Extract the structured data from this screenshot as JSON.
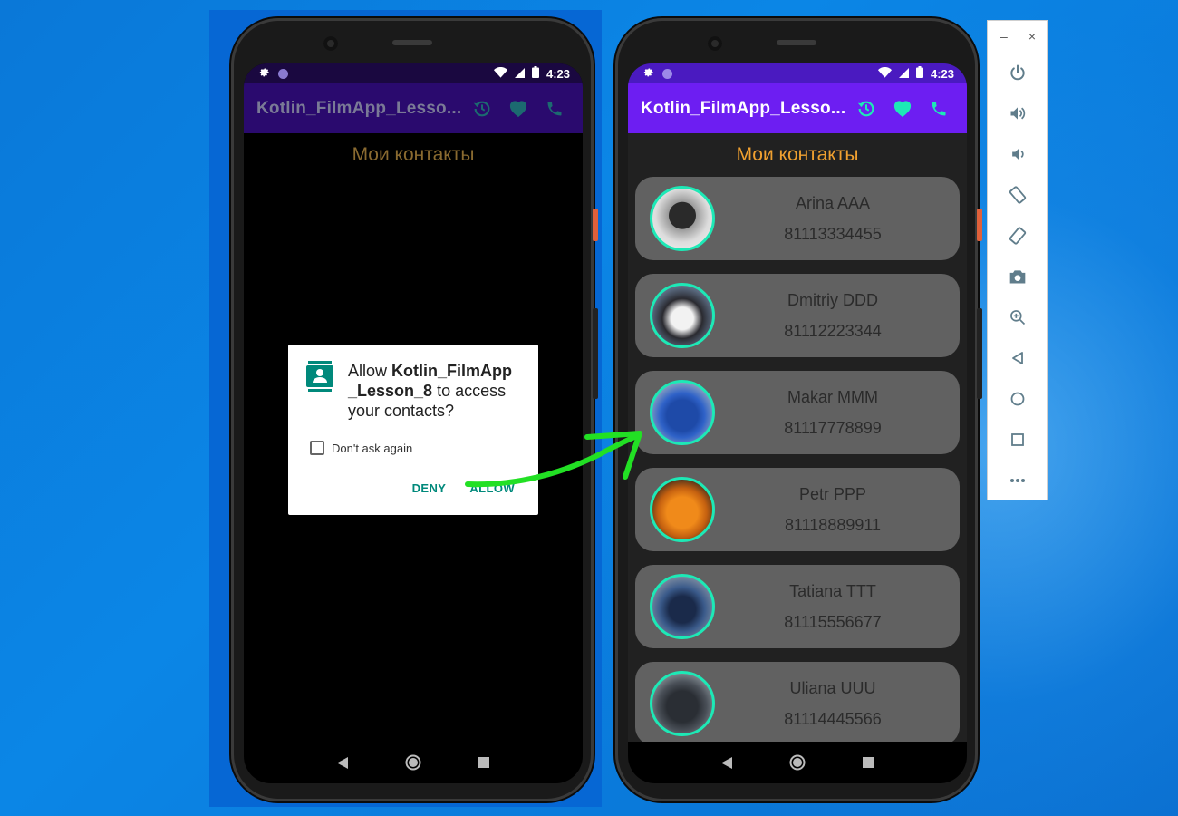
{
  "left_phone": {
    "status_time": "4:23",
    "app_title": "Kotlin_FilmApp_Lesso...",
    "heading": "Мои контакты",
    "dialog": {
      "msg_prefix": "Allow ",
      "app_name": "Kotlin_FilmApp _Lesson_8",
      "msg_suffix": " to access your contacts?",
      "checkbox_label": "Don't ask again",
      "deny_label": "DENY",
      "allow_label": "ALLOW"
    }
  },
  "right_phone": {
    "status_time": "4:23",
    "app_title": "Kotlin_FilmApp_Lesso...",
    "heading": "Мои контакты",
    "contacts": [
      {
        "name": "Arina AAA",
        "phone": "81113334455"
      },
      {
        "name": "Dmitriy DDD",
        "phone": "81112223344"
      },
      {
        "name": "Makar MMM",
        "phone": "81117778899"
      },
      {
        "name": "Petr PPP",
        "phone": "81118889911"
      },
      {
        "name": "Tatiana TTT",
        "phone": "81115556677"
      },
      {
        "name": "Uliana UUU",
        "phone": "81114445566"
      }
    ]
  },
  "emulator_toolbar": {
    "minimize": "–",
    "close": "×",
    "items": [
      "power-icon",
      "volume-up-icon",
      "volume-down-icon",
      "rotate-left-icon",
      "rotate-right-icon",
      "camera-icon",
      "zoom-in-icon",
      "back-icon",
      "home-icon",
      "overview-icon",
      "more-icon"
    ]
  },
  "colors": {
    "accent_teal": "#1de9b6",
    "app_bar_purple": "#6d1ef2",
    "heading_orange": "#f0a030",
    "allow_teal": "#00897b"
  }
}
